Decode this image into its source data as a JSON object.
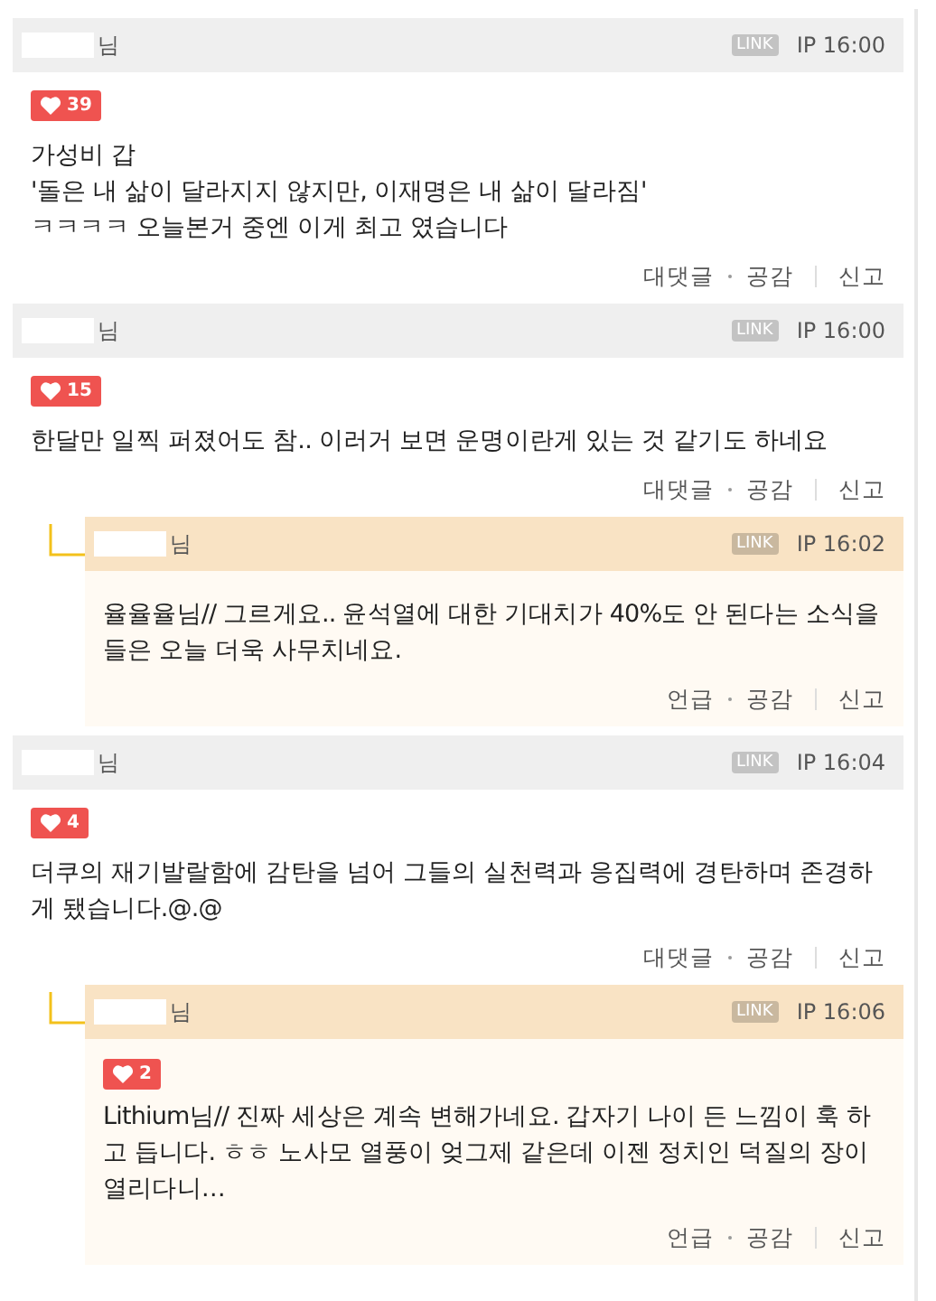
{
  "comments": [
    {
      "kind": "comment",
      "author": "님",
      "link": "LINK",
      "ip": "IP 16:00",
      "likes": "39",
      "text": "가성비 갑\n'돌은 내 삶이 달라지지 않지만, 이재명은 내 삶이 달라짐'\nㅋㅋㅋㅋ 오늘본거 중엔 이게 최고 였습니다",
      "actions": [
        "대댓글",
        "공감",
        "신고"
      ]
    },
    {
      "kind": "comment",
      "author": "님",
      "link": "LINK",
      "ip": "IP 16:00",
      "likes": "15",
      "text": "한달만 일찍 퍼졌어도 참.. 이러거 보면 운명이란게 있는 것 같기도 하네요",
      "actions": [
        "대댓글",
        "공감",
        "신고"
      ]
    },
    {
      "kind": "reply",
      "author": "님",
      "link": "LINK",
      "ip": "IP 16:02",
      "text": "율율율님// 그르게요.. 윤석열에 대한 기대치가 40%도 안 된다는 소식을 들은 오늘 더욱 사무치네요.",
      "actions": [
        "언급",
        "공감",
        "신고"
      ]
    },
    {
      "kind": "comment",
      "author": "님",
      "link": "LINK",
      "ip": "IP 16:04",
      "likes": "4",
      "text": "더쿠의 재기발랄함에 감탄을 넘어 그들의 실천력과 응집력에 경탄하며 존경하게 됐습니다.@.@",
      "actions": [
        "대댓글",
        "공감",
        "신고"
      ]
    },
    {
      "kind": "reply",
      "author": "님",
      "link": "LINK",
      "ip": "IP 16:06",
      "likes": "2",
      "text": "Lithium님// 진짜 세상은 계속 변해가네요. 갑자기 나이 든 느낌이 훅 하고 듭니다. ㅎㅎ 노사모 열풍이 엊그제 같은데 이젠 정치인 덕질의 장이 열리다니…",
      "actions": [
        "언급",
        "공감",
        "신고"
      ]
    }
  ]
}
